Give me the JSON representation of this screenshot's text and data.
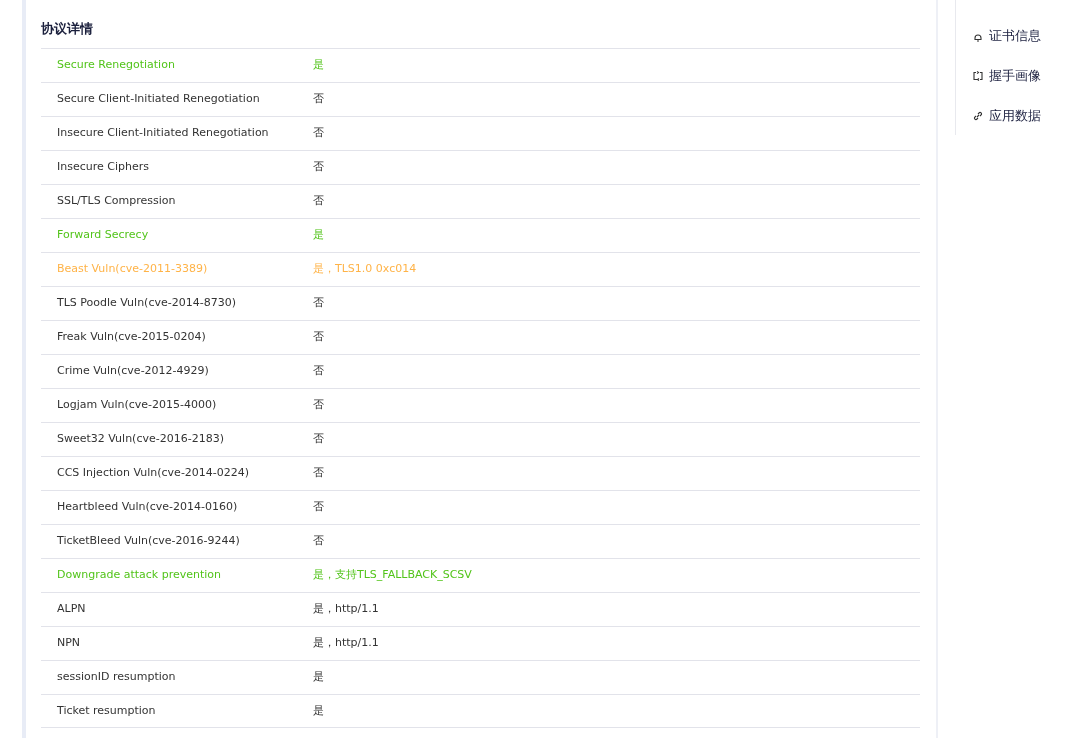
{
  "section": {
    "title": "协议详情"
  },
  "rows": [
    {
      "name": "Secure Renegotiation",
      "value": "是",
      "color": "#52c41a"
    },
    {
      "name": "Secure Client-Initiated Renegotiation",
      "value": "否",
      "color": "#333333"
    },
    {
      "name": "Insecure Client-Initiated Renegotiation",
      "value": "否",
      "color": "#333333"
    },
    {
      "name": "Insecure Ciphers",
      "value": "否",
      "color": "#333333"
    },
    {
      "name": "SSL/TLS Compression",
      "value": "否",
      "color": "#333333"
    },
    {
      "name": "Forward Secrecy",
      "value": "是",
      "color": "#52c41a"
    },
    {
      "name": "Beast Vuln(cve-2011-3389)",
      "value": "是，TLS1.0 0xc014",
      "color": "#ffb347"
    },
    {
      "name": "TLS Poodle Vuln(cve-2014-8730)",
      "value": "否",
      "color": "#333333"
    },
    {
      "name": "Freak Vuln(cve-2015-0204)",
      "value": "否",
      "color": "#333333"
    },
    {
      "name": "Crime Vuln(cve-2012-4929)",
      "value": "否",
      "color": "#333333"
    },
    {
      "name": "Logjam Vuln(cve-2015-4000)",
      "value": "否",
      "color": "#333333"
    },
    {
      "name": "Sweet32 Vuln(cve-2016-2183)",
      "value": "否",
      "color": "#333333"
    },
    {
      "name": "CCS Injection Vuln(cve-2014-0224)",
      "value": "否",
      "color": "#333333"
    },
    {
      "name": "Heartbleed Vuln(cve-2014-0160)",
      "value": "否",
      "color": "#333333"
    },
    {
      "name": "TicketBleed Vuln(cve-2016-9244)",
      "value": "否",
      "color": "#333333"
    },
    {
      "name": "Downgrade attack prevention",
      "value": "是，支持TLS_FALLBACK_SCSV",
      "color": "#52c41a"
    },
    {
      "name": "ALPN",
      "value": "是，http/1.1",
      "color": "#333333"
    },
    {
      "name": "NPN",
      "value": "是，http/1.1",
      "color": "#333333"
    },
    {
      "name": "sessionID resumption",
      "value": "是",
      "color": "#333333"
    },
    {
      "name": "Ticket resumption",
      "value": "是",
      "color": "#333333"
    }
  ],
  "nav": {
    "items": [
      {
        "label": "证书信息",
        "kind": "cert"
      },
      {
        "label": "握手画像",
        "kind": "handshake"
      },
      {
        "label": "应用数据",
        "kind": "link"
      }
    ]
  }
}
